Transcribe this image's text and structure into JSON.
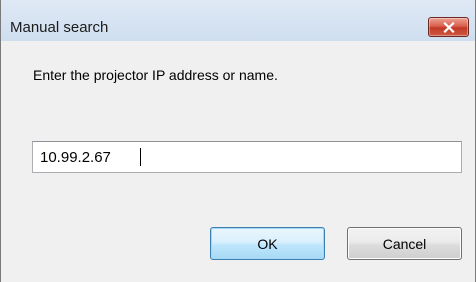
{
  "window": {
    "title": "Manual search",
    "close_icon": "close-icon"
  },
  "dialog": {
    "prompt": "Enter the projector IP address or name.",
    "address_value": "10.99.2.67",
    "ok_label": "OK",
    "cancel_label": "Cancel"
  },
  "colors": {
    "close_button": "#c9452f",
    "ok_button_border": "#3c7fb1",
    "dialog_background": "#f0f0f0"
  }
}
